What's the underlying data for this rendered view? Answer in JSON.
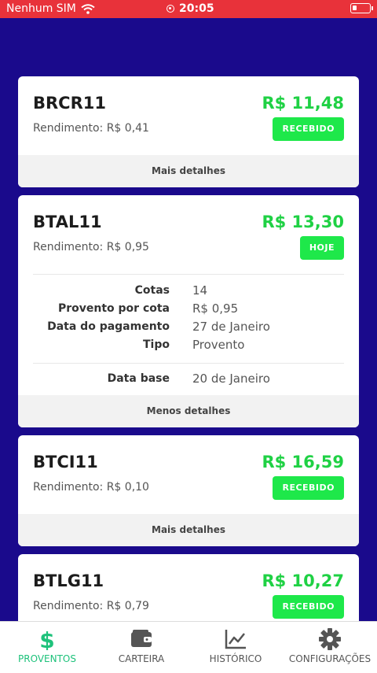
{
  "status_bar": {
    "carrier": "Nenhum SIM",
    "time": "20:05"
  },
  "cards": [
    {
      "ticker": "BRCR11",
      "value": "R$ 11,48",
      "yield": "Rendimento: R$ 0,41",
      "badge": "RECEBIDO",
      "footer": "Mais detalhes"
    },
    {
      "ticker": "BTAL11",
      "value": "R$ 13,30",
      "yield": "Rendimento: R$ 0,95",
      "badge": "HOJE",
      "footer": "Menos detalhes",
      "details": {
        "cotas_label": "Cotas",
        "cotas": "14",
        "provento_label": "Provento por cota",
        "provento": "R$ 0,95",
        "pagamento_label": "Data do pagamento",
        "pagamento": "27 de Janeiro",
        "tipo_label": "Tipo",
        "tipo": "Provento",
        "base_label": "Data base",
        "base": "20 de Janeiro"
      }
    },
    {
      "ticker": "BTCI11",
      "value": "R$ 16,59",
      "yield": "Rendimento: R$ 0,10",
      "badge": "RECEBIDO",
      "footer": "Mais detalhes"
    },
    {
      "ticker": "BTLG11",
      "value": "R$ 10,27",
      "yield": "Rendimento: R$ 0,79",
      "badge": "RECEBIDO"
    }
  ],
  "tabs": [
    {
      "label": "PROVENTOS",
      "icon": "dollar-icon",
      "active": true
    },
    {
      "label": "CARTEIRA",
      "icon": "wallet-icon"
    },
    {
      "label": "HISTÓRICO",
      "icon": "chart-line-icon"
    },
    {
      "label": "CONFIGURAÇÕES",
      "icon": "gear-icon"
    }
  ],
  "colors": {
    "background": "#1a0a8c",
    "status_bar": "#e8323a",
    "value_green": "#1fd144",
    "badge_green": "#1ee84a",
    "tab_active": "#1ec27b"
  }
}
